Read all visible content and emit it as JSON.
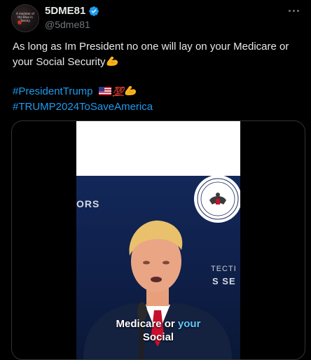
{
  "author": {
    "display_name": "5DME81",
    "handle": "@5dme81",
    "avatar_caption": "A member of the Blue in Twenty"
  },
  "icons": {
    "verified": "verified-badge-icon",
    "more": "more-options-icon",
    "flex": "flexed-biceps-emoji",
    "flag": "us-flag-emoji",
    "hundred": "hundred-points-emoji"
  },
  "tweet": {
    "body_line1": "As long as Im President no one will lay on your Medicare or",
    "body_line2": "your Social Security",
    "hashtag1": "#PresidentTrump",
    "hashtag2": "#TRUMP2024ToSaveAmerica"
  },
  "media": {
    "backdrop_left_text": "ORS",
    "backdrop_right_text1": "TECTI",
    "backdrop_right_text2": "S SE",
    "caption_prefix": "Medicare or ",
    "caption_highlight": "your",
    "caption_line2": "Social"
  },
  "colors": {
    "background": "#000000",
    "text": "#e7e9ea",
    "secondary_text": "#71767b",
    "link": "#1d9bf0",
    "verified": "#1d9bf0",
    "caption_highlight": "#5ec8ff"
  }
}
